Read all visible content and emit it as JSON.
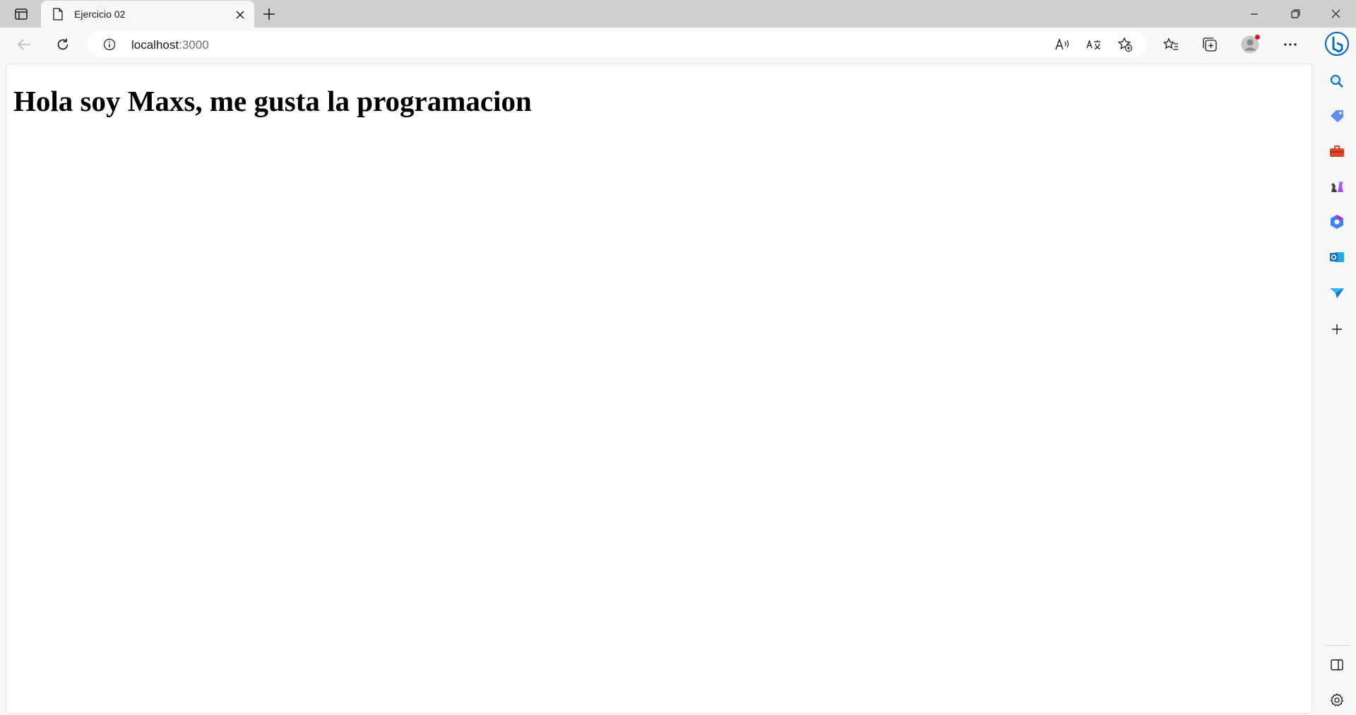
{
  "browser": {
    "tab": {
      "title": "Ejercicio 02"
    },
    "address_bar": {
      "host": "localhost",
      "port": ":3000"
    },
    "icons": {
      "tab_actions": "tab-actions-icon",
      "page": "page-icon",
      "close": "close-icon",
      "new_tab": "plus-icon",
      "minimize": "minimize-icon",
      "restore": "restore-icon",
      "window_close": "close-icon",
      "back": "back-arrow-icon",
      "refresh": "refresh-icon",
      "info": "info-icon",
      "read_aloud": "read-aloud-icon",
      "translate": "translate-icon",
      "add_favorite": "star-plus-icon",
      "favorites": "favorites-icon",
      "collections": "collections-icon",
      "profile": "profile-icon",
      "more": "more-icon",
      "copilot": "bing-copilot-icon"
    },
    "sidebar": [
      "search-icon",
      "shopping-tag-icon",
      "tools-icon",
      "games-icon",
      "office-icon",
      "outlook-icon",
      "send-icon",
      "add-icon",
      "split-screen-icon",
      "settings-icon"
    ],
    "colors": {
      "tabstrip": "#cfcfcf",
      "chrome": "#f7f7f7",
      "accent": "#0f6cbd",
      "notification": "#e81123"
    }
  },
  "page": {
    "heading": "Hola soy Maxs, me gusta la programacion"
  }
}
